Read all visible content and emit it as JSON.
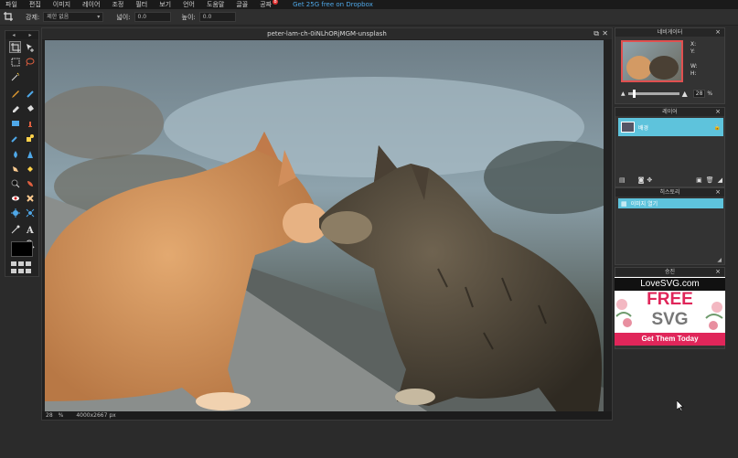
{
  "menubar": {
    "items": [
      "파일",
      "편집",
      "이미지",
      "레이어",
      "조정",
      "필터",
      "보기",
      "언어",
      "도움말",
      "글꼴",
      "공짜"
    ],
    "badge": "8",
    "dropbox_link": "Get 25G free on Dropbox"
  },
  "options": {
    "constraint_label": "강제:",
    "constraint_value": "제한 없음",
    "width_label": "넓이:",
    "width_value": "0.0",
    "height_label": "높이:",
    "height_value": "0.0"
  },
  "canvas": {
    "title": "peter-lam-ch-0iNLhORjMGM-unsplash",
    "zoom": "28",
    "zoom_unit": "%",
    "dimensions": "4000x2667 px"
  },
  "navigator": {
    "title": "네비게이터",
    "x_label": "X:",
    "y_label": "Y:",
    "w_label": "W:",
    "h_label": "H:",
    "zoom_value": "28",
    "zoom_unit": "%"
  },
  "layers": {
    "title": "레이어",
    "items": [
      {
        "name": "배경"
      }
    ]
  },
  "history": {
    "title": "히스토리",
    "items": [
      {
        "name": "이미지 열기"
      }
    ]
  },
  "ad_panel": {
    "title": "승진",
    "brand": "LoveSVG.com",
    "line1": "FREE",
    "line2": "SVG",
    "cta": "Get Them Today"
  },
  "colors": {
    "accent": "#5ec3dc",
    "ad_red": "#e0265a",
    "badge": "#e03030"
  }
}
